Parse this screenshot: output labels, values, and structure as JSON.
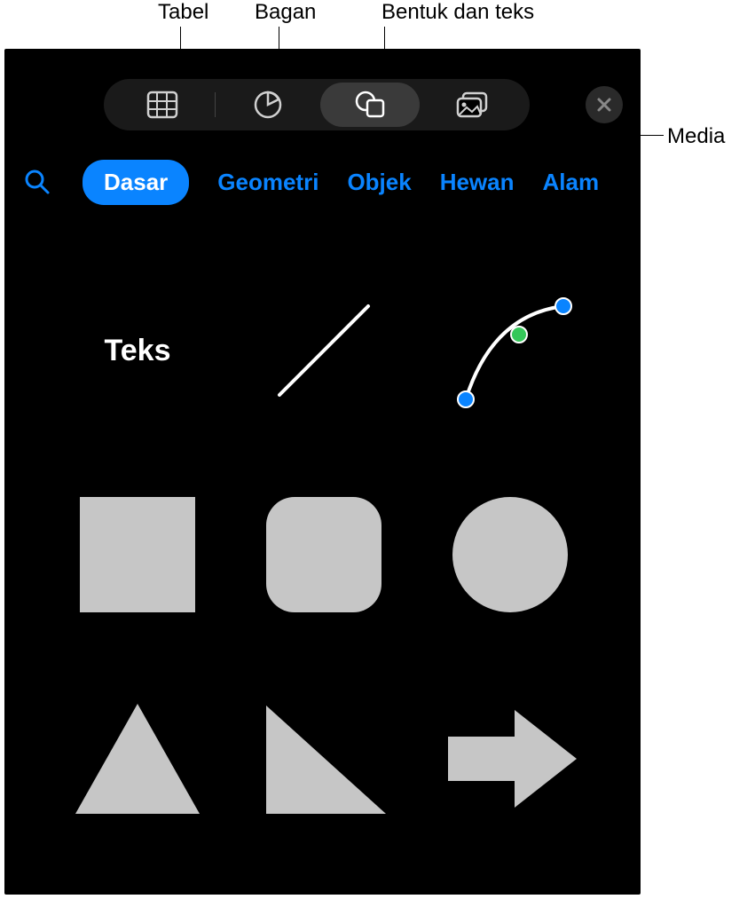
{
  "callouts": {
    "table": "Tabel",
    "chart": "Bagan",
    "shapes_text": "Bentuk dan teks",
    "media": "Media"
  },
  "toolbar": {
    "items": [
      {
        "name": "table-icon"
      },
      {
        "name": "chart-icon"
      },
      {
        "name": "shapes-icon",
        "selected": true
      },
      {
        "name": "media-icon"
      }
    ]
  },
  "categories": {
    "items": [
      {
        "label": "Dasar",
        "selected": true
      },
      {
        "label": "Geometri"
      },
      {
        "label": "Objek"
      },
      {
        "label": "Hewan"
      },
      {
        "label": "Alam"
      }
    ]
  },
  "shapes": {
    "text_label": "Teks",
    "items": [
      {
        "name": "text-shape",
        "type": "text"
      },
      {
        "name": "line-shape",
        "type": "line"
      },
      {
        "name": "curve-shape",
        "type": "curve"
      },
      {
        "name": "square-shape",
        "type": "square"
      },
      {
        "name": "rounded-square-shape",
        "type": "rounded-square"
      },
      {
        "name": "circle-shape",
        "type": "circle"
      },
      {
        "name": "triangle-shape",
        "type": "triangle"
      },
      {
        "name": "right-triangle-shape",
        "type": "right-triangle"
      },
      {
        "name": "arrow-right-shape",
        "type": "arrow-right"
      }
    ]
  },
  "colors": {
    "accent": "#0a84ff",
    "shape_fill": "#c6c6c6",
    "line_stroke": "#ffffff",
    "curve_dot_blue": "#0a84ff",
    "curve_dot_green": "#34c759"
  }
}
